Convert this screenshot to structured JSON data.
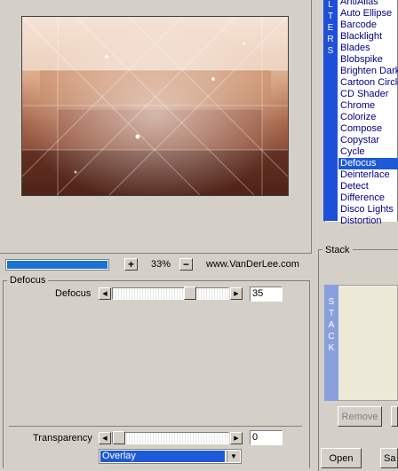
{
  "preview": {
    "zoom_percent": "33%",
    "site": "www.VanDerLee.com",
    "progress_fraction": 1.0
  },
  "zoom_buttons": {
    "plus": "+",
    "minus": "−"
  },
  "defocus_group": {
    "title": "Defocus",
    "slider_label": "Defocus",
    "value": "35",
    "slider_fraction": 0.65
  },
  "transparency": {
    "label": "Transparency",
    "value": "0",
    "slider_fraction": 0.0
  },
  "blend_mode": {
    "selected": "Overlay"
  },
  "filters": {
    "tab_label": [
      "L",
      "T",
      "E",
      "R",
      "S"
    ],
    "items": [
      "AntiAlias",
      "Auto Ellipse",
      "Barcode",
      "Blacklight",
      "Blades",
      "Blobspike",
      "Brighten Dark",
      "Cartoon Circle",
      "CD Shader",
      "Chrome",
      "Colorize",
      "Compose",
      "Copystar",
      "Cycle",
      "Defocus",
      "Deinterlace",
      "Detect",
      "Difference",
      "Disco Lights",
      "Distortion"
    ],
    "selected": "Defocus"
  },
  "stack": {
    "title": "Stack",
    "tab_label": [
      "S",
      "T",
      "A",
      "C",
      "K"
    ],
    "remove_label": "Remove"
  },
  "bottom_buttons": {
    "open": "Open",
    "save": "Sa"
  }
}
